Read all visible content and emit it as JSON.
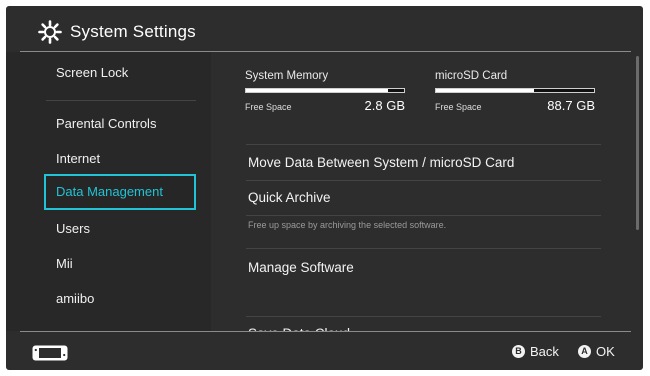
{
  "header": {
    "title": "System Settings",
    "icon": "gear-icon"
  },
  "sidebar": {
    "items": [
      {
        "label": "Screen Lock",
        "selected": false
      },
      {
        "label": "Parental Controls",
        "selected": false
      },
      {
        "label": "Internet",
        "selected": false
      },
      {
        "label": "Data Management",
        "selected": true
      },
      {
        "label": "Users",
        "selected": false
      },
      {
        "label": "Mii",
        "selected": false
      },
      {
        "label": "amiibo",
        "selected": false
      }
    ]
  },
  "storage": {
    "system": {
      "name": "System Memory",
      "free_label": "Free Space",
      "free_value": "2.8 GB",
      "used_fraction": 0.9
    },
    "microsd": {
      "name": "microSD Card",
      "free_label": "Free Space",
      "free_value": "88.7 GB",
      "used_fraction": 0.62
    }
  },
  "main": {
    "items": [
      {
        "label": "Move Data Between System / microSD Card"
      },
      {
        "label": "Quick Archive",
        "description": "Free up space by archiving the selected software."
      },
      {
        "label": "Manage Software"
      },
      {
        "label": "Save Data Cloud"
      }
    ]
  },
  "footer": {
    "back": {
      "button": "B",
      "label": "Back"
    },
    "ok": {
      "button": "A",
      "label": "OK"
    }
  },
  "colors": {
    "background": "#2d2d2d",
    "sidebar": "#282828",
    "accent": "#21c3d6",
    "text": "#ffffff"
  }
}
